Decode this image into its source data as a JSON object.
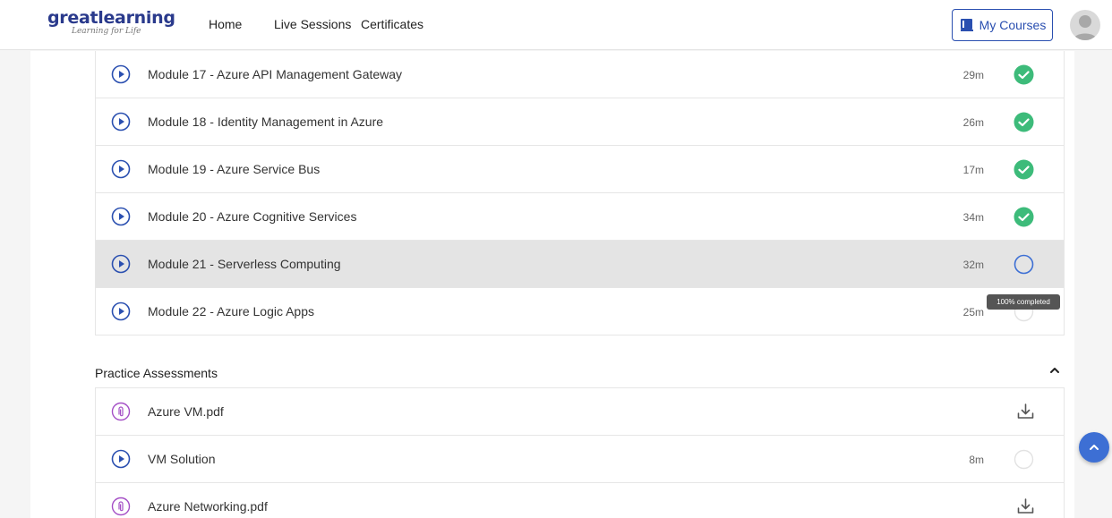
{
  "header": {
    "logo_main": "greatlearning",
    "logo_tag": "Learning for Life",
    "nav": [
      {
        "label": "Home"
      },
      {
        "label": "Live Sessions"
      },
      {
        "label": "Certificates"
      }
    ],
    "my_courses_label": "My Courses"
  },
  "modules": [
    {
      "title": "Module 17 - Azure API Management Gateway",
      "duration": "29m",
      "status": "completed"
    },
    {
      "title": "Module 18 - Identity Management in Azure",
      "duration": "26m",
      "status": "completed"
    },
    {
      "title": "Module 19 - Azure Service Bus",
      "duration": "17m",
      "status": "completed"
    },
    {
      "title": "Module 20 - Azure Cognitive Services",
      "duration": "34m",
      "status": "completed"
    },
    {
      "title": "Module 21 - Serverless Computing",
      "duration": "32m",
      "status": "in-progress"
    },
    {
      "title": "Module 22 - Azure Logic Apps",
      "duration": "25m",
      "status": "not-started"
    }
  ],
  "tooltip": "100% completed",
  "practice": {
    "title": "Practice Assessments",
    "items": [
      {
        "title": "Azure VM.pdf",
        "type": "pdf",
        "icon": "paperclip-icon",
        "action_icon": "download-icon"
      },
      {
        "title": "VM Solution",
        "type": "video",
        "duration": "8m",
        "icon": "play-circle-icon",
        "status": "not-started"
      },
      {
        "title": "Azure Networking.pdf",
        "type": "pdf",
        "icon": "paperclip-icon",
        "action_icon": "download-icon"
      }
    ]
  },
  "colors": {
    "brand": "#2a3a8c",
    "accent": "#3d6fd4",
    "completed": "#3dbb7a",
    "pdf_icon": "#a44fc6",
    "active_row": "#e4e4e4"
  }
}
